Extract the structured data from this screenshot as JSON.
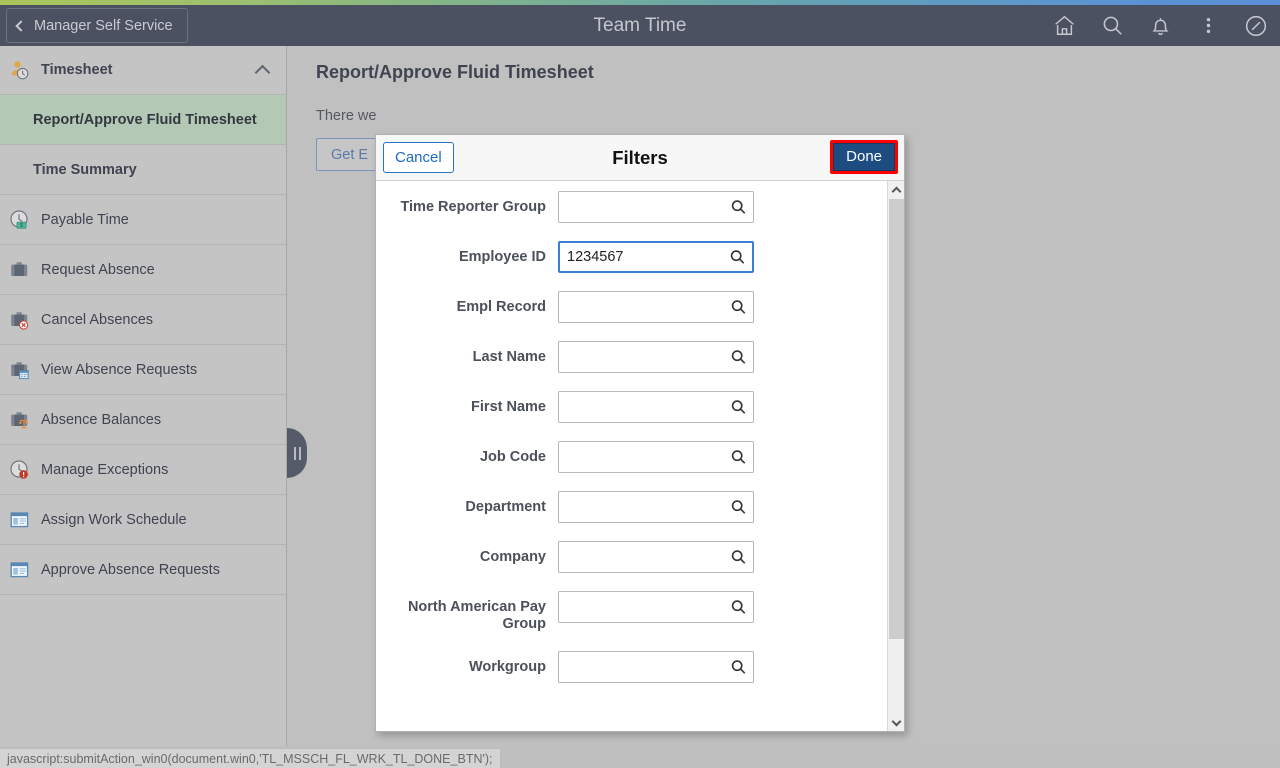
{
  "header": {
    "back_label": "Manager Self Service",
    "title": "Team Time",
    "icons": [
      {
        "name": "home-icon",
        "label": "Home"
      },
      {
        "name": "search-icon",
        "label": "Search"
      },
      {
        "name": "bell-icon",
        "label": "Notifications"
      },
      {
        "name": "kebab-menu-icon",
        "label": "Actions"
      },
      {
        "name": "navbar-icon",
        "label": "NavBar"
      }
    ],
    "bar_color": "#4b5160",
    "accent_gradient_start": "#aac55a",
    "accent_gradient_end": "#5b8fd6"
  },
  "sidebar": {
    "group": {
      "label": "Timesheet",
      "icon": "person-clock-icon",
      "expanded": true
    },
    "items": [
      {
        "label": "Report/Approve Fluid Timesheet",
        "sub": true,
        "active": true,
        "icon": ""
      },
      {
        "label": "Time Summary",
        "sub": true,
        "active": false,
        "icon": ""
      },
      {
        "label": "Payable Time",
        "sub": false,
        "active": false,
        "icon": "clock-money-icon"
      },
      {
        "label": "Request Absence",
        "sub": false,
        "active": false,
        "icon": "briefcase-icon"
      },
      {
        "label": "Cancel Absences",
        "sub": false,
        "active": false,
        "icon": "briefcase-cancel-icon"
      },
      {
        "label": "View Absence Requests",
        "sub": false,
        "active": false,
        "icon": "briefcase-calendar-icon"
      },
      {
        "label": "Absence Balances",
        "sub": false,
        "active": false,
        "icon": "briefcase-scale-icon"
      },
      {
        "label": "Manage Exceptions",
        "sub": false,
        "active": false,
        "icon": "clock-alert-icon"
      },
      {
        "label": "Assign Work Schedule",
        "sub": false,
        "active": false,
        "icon": "window-icon"
      },
      {
        "label": "Approve Absence Requests",
        "sub": false,
        "active": false,
        "icon": "window-icon"
      }
    ],
    "active_color": "#b3c9b6",
    "collapse_handle": "pause-bars-icon"
  },
  "main": {
    "page_title": "Report/Approve Fluid Timesheet",
    "message": "There we",
    "get_button": "Get E"
  },
  "modal": {
    "cancel_label": "Cancel",
    "title": "Filters",
    "done_label": "Done",
    "done_highlight_color": "#ff0000",
    "done_button_color": "#1c4c80",
    "fields": [
      {
        "label": "Time Reporter Group",
        "value": "",
        "focused": false
      },
      {
        "label": "Employee ID",
        "value": "1234567",
        "focused": true
      },
      {
        "label": "Empl Record",
        "value": "",
        "focused": false
      },
      {
        "label": "Last Name",
        "value": "",
        "focused": false
      },
      {
        "label": "First Name",
        "value": "",
        "focused": false
      },
      {
        "label": "Job Code",
        "value": "",
        "focused": false
      },
      {
        "label": "Department",
        "value": "",
        "focused": false
      },
      {
        "label": "Company",
        "value": "",
        "focused": false
      },
      {
        "label": "North American Pay Group",
        "value": "",
        "focused": false
      },
      {
        "label": "Workgroup",
        "value": "",
        "focused": false
      }
    ],
    "lookup_icon": "magnifier-icon",
    "scrollbar": {
      "up_icon": "chevron-up-icon",
      "down_icon": "chevron-down-icon"
    }
  },
  "status_bar": {
    "text": "javascript:submitAction_win0(document.win0,'TL_MSSCH_FL_WRK_TL_DONE_BTN');"
  }
}
